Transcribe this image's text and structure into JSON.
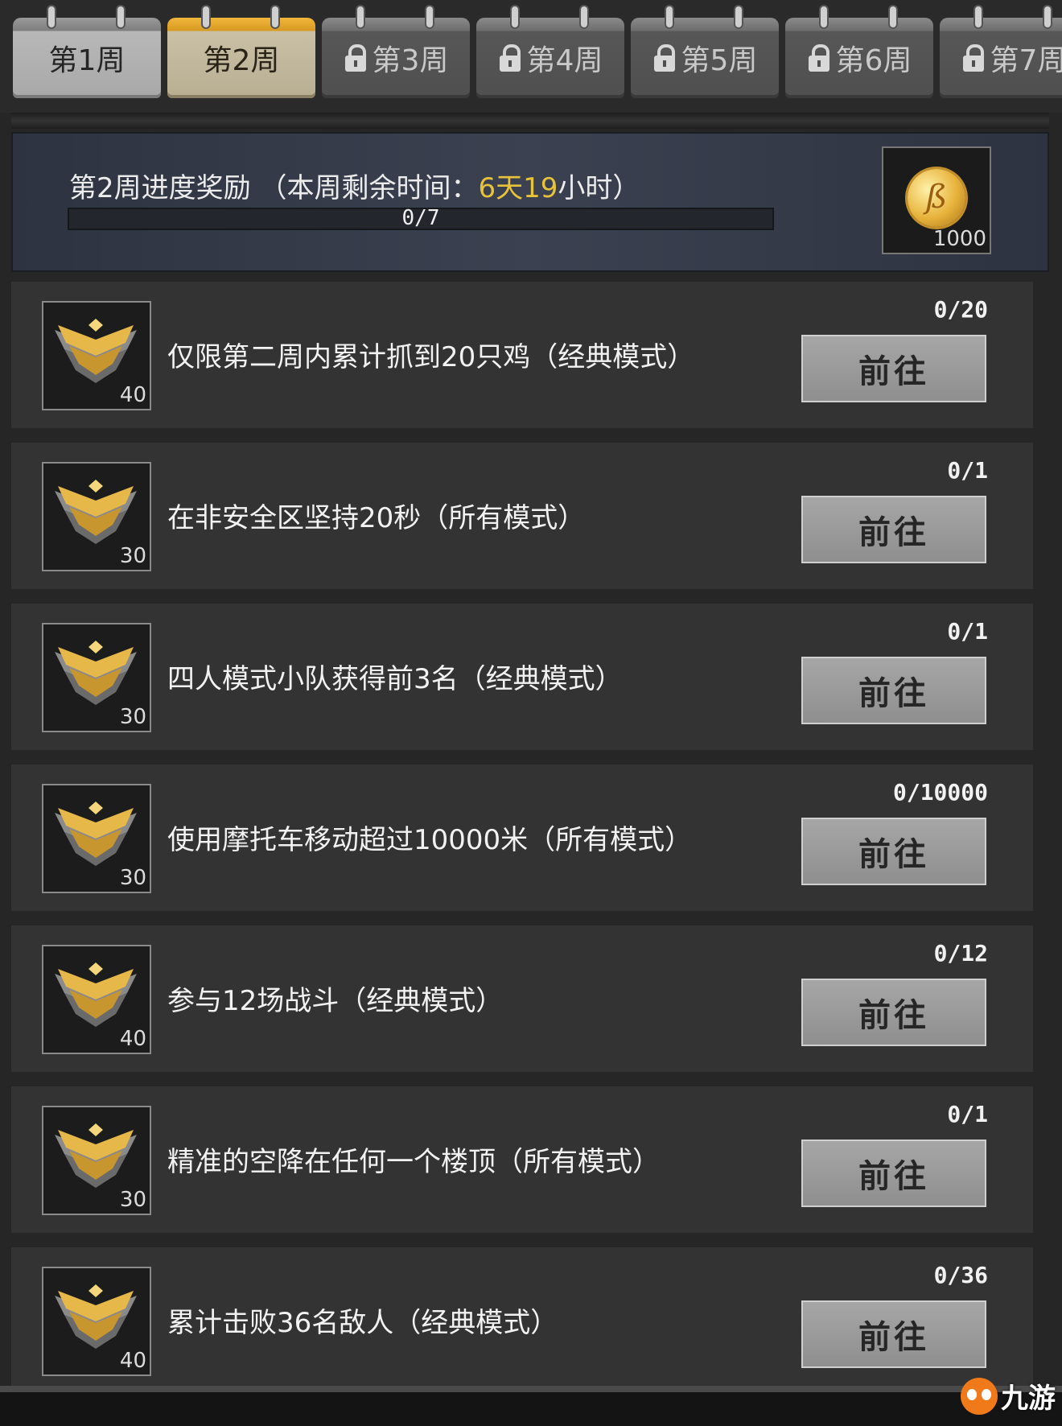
{
  "tabs": [
    {
      "label": "第1周",
      "locked": false,
      "active": false
    },
    {
      "label": "第2周",
      "locked": false,
      "active": true
    },
    {
      "label": "第3周",
      "locked": true,
      "active": false
    },
    {
      "label": "第4周",
      "locked": true,
      "active": false
    },
    {
      "label": "第5周",
      "locked": true,
      "active": false
    },
    {
      "label": "第6周",
      "locked": true,
      "active": false
    },
    {
      "label": "第7周",
      "locked": true,
      "active": false
    }
  ],
  "progress": {
    "title_prefix": "第2周进度奖励 （本周剩余时间：",
    "days": "6天",
    "hours": "19",
    "title_suffix": "小时）",
    "value_text": "0/7",
    "fraction": 0,
    "reward_amount": "1000",
    "reward_icon": "coin-icon"
  },
  "tasks": [
    {
      "text": "仅限第二周内累计抓到20只鸡（经典模式）",
      "progress": "0/20",
      "points": "40",
      "button": "前往"
    },
    {
      "text": "在非安全区坚持20秒（所有模式）",
      "progress": "0/1",
      "points": "30",
      "button": "前往"
    },
    {
      "text": "四人模式小队获得前3名（经典模式）",
      "progress": "0/1",
      "points": "30",
      "button": "前往"
    },
    {
      "text": "使用摩托车移动超过10000米（所有模式）",
      "progress": "0/10000",
      "points": "30",
      "button": "前往"
    },
    {
      "text": "参与12场战斗（经典模式）",
      "progress": "0/12",
      "points": "40",
      "button": "前往"
    },
    {
      "text": "精准的空降在任何一个楼顶（所有模式）",
      "progress": "0/1",
      "points": "30",
      "button": "前往"
    },
    {
      "text": "累计击败36名敌人（经典模式）",
      "progress": "0/36",
      "points": "40",
      "button": "前往"
    }
  ],
  "watermark": {
    "text": "九游"
  },
  "colors": {
    "accent": "#e8c23a",
    "active_tab": "#d89a22",
    "panel": "#333333"
  }
}
